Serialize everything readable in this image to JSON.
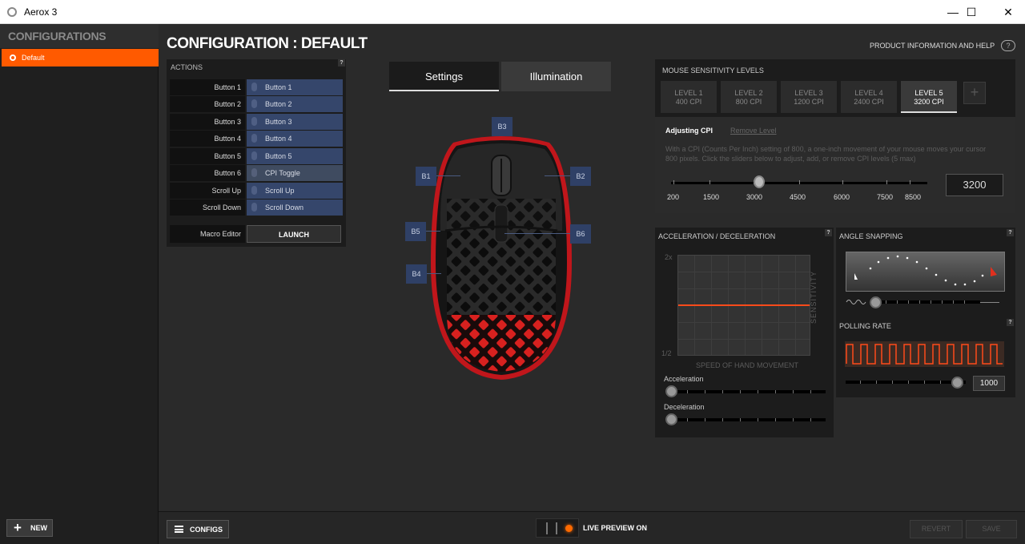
{
  "window": {
    "title": "Aerox 3",
    "minimize": "—",
    "maximize": "☐",
    "close": "✕"
  },
  "sidebar": {
    "header": "CONFIGURATIONS",
    "items": [
      {
        "label": "Default",
        "selected": true
      }
    ],
    "new_label": "NEW"
  },
  "main": {
    "title": "CONFIGURATION : DEFAULT",
    "product_info": "PRODUCT INFORMATION AND HELP"
  },
  "actions": {
    "header": "ACTIONS",
    "rows": [
      {
        "label": "Button 1",
        "value": "Button 1"
      },
      {
        "label": "Button 2",
        "value": "Button 2"
      },
      {
        "label": "Button 3",
        "value": "Button 3"
      },
      {
        "label": "Button 4",
        "value": "Button 4"
      },
      {
        "label": "Button 5",
        "value": "Button 5"
      },
      {
        "label": "Button 6",
        "value": "CPI Toggle"
      },
      {
        "label": "Scroll Up",
        "value": "Scroll Up"
      },
      {
        "label": "Scroll Down",
        "value": "Scroll Down"
      }
    ],
    "macro_label": "Macro Editor",
    "launch_label": "LAUNCH"
  },
  "tabs": [
    {
      "label": "Settings",
      "active": true
    },
    {
      "label": "Illumination",
      "active": false
    }
  ],
  "mouse_buttons": [
    "B1",
    "B2",
    "B3",
    "B4",
    "B5",
    "B6"
  ],
  "sensitivity": {
    "header": "MOUSE SENSITIVITY LEVELS",
    "levels": [
      {
        "name": "LEVEL 1",
        "cpi": "400 CPI"
      },
      {
        "name": "LEVEL 2",
        "cpi": "800 CPI"
      },
      {
        "name": "LEVEL 3",
        "cpi": "1200 CPI"
      },
      {
        "name": "LEVEL 4",
        "cpi": "2400 CPI"
      },
      {
        "name": "LEVEL 5",
        "cpi": "3200 CPI"
      }
    ],
    "active_level": 4,
    "add_label": "+",
    "adjusting_label": "Adjusting CPI",
    "remove_label": "Remove Level",
    "description": "With a CPI (Counts Per Inch) setting of 800, a one-inch movement of your mouse moves your cursor 800 pixels. Click the sliders below to adjust, add, or remove CPI levels (5 max)",
    "scale_labels": [
      "200",
      "1500",
      "3000",
      "4500",
      "6000",
      "7500",
      "8500"
    ],
    "value": "3200"
  },
  "acceleration": {
    "header": "ACCELERATION / DECELERATION",
    "y_top": "2x",
    "y_bottom": "1/2",
    "y_label": "SENSITIVITY",
    "x_label": "SPEED OF HAND MOVEMENT",
    "accel_label": "Acceleration",
    "decel_label": "Deceleration"
  },
  "angle_snapping": {
    "header": "ANGLE SNAPPING"
  },
  "polling": {
    "header": "POLLING RATE",
    "value": "1000"
  },
  "help": "?",
  "bottom": {
    "configs_label": "CONFIGS",
    "live_preview": "LIVE PREVIEW ON",
    "revert_label": "REVERT",
    "save_label": "SAVE"
  },
  "colors": {
    "accent": "#ff5a00",
    "button_blue": "#35466b",
    "panel": "#1c1c1c"
  }
}
